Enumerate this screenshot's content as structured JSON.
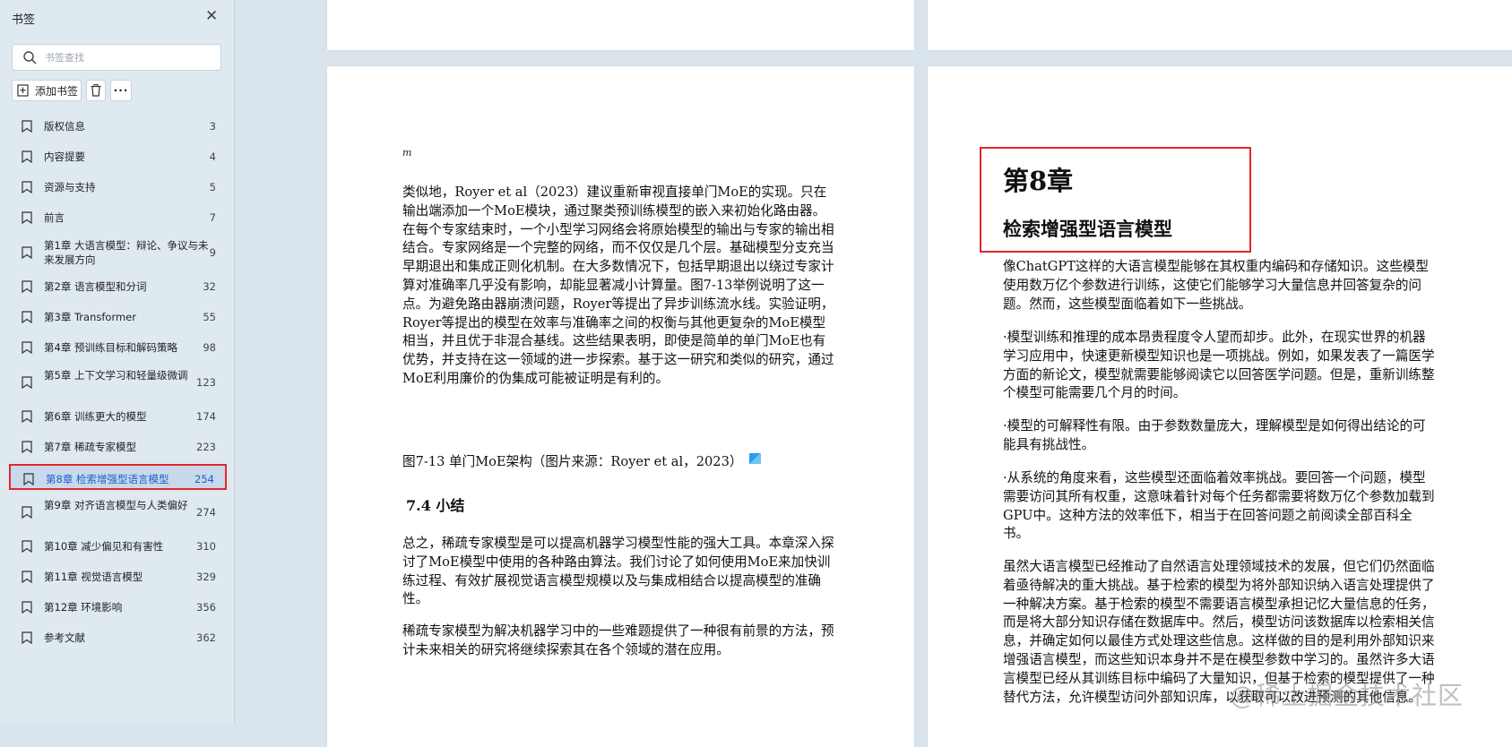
{
  "sidebar": {
    "title": "书签",
    "search": {
      "placeholder": "书签查找",
      "value": ""
    },
    "add_label": "添加书签",
    "more_label": "···",
    "items": [
      {
        "label": "版权信息",
        "page": "3"
      },
      {
        "label": "内容提要",
        "page": "4"
      },
      {
        "label": "资源与支持",
        "page": "5"
      },
      {
        "label": "前言",
        "page": "7"
      },
      {
        "label": "第1章 大语言模型：辩论、争议与未来发展方向",
        "page": "9"
      },
      {
        "label": "第2章 语言模型和分词",
        "page": "32"
      },
      {
        "label": "第3章 Transformer",
        "page": "55"
      },
      {
        "label": "第4章 预训练目标和解码策略",
        "page": "98"
      },
      {
        "label": "第5章 上下文学习和轻量级微调",
        "page": "123"
      },
      {
        "label": "第6章 训练更大的模型",
        "page": "174"
      },
      {
        "label": "第7章 稀疏专家模型",
        "page": "223"
      },
      {
        "label": "第8章 检索增强型语言模型",
        "page": "254",
        "active": true
      },
      {
        "label": "第9章 对齐语言模型与人类偏好",
        "page": "274"
      },
      {
        "label": "第10章 减少偏见和有害性",
        "page": "310"
      },
      {
        "label": "第11章 视觉语言模型",
        "page": "329"
      },
      {
        "label": "第12章 环境影响",
        "page": "356"
      },
      {
        "label": "参考文献",
        "page": "362"
      }
    ]
  },
  "left_page": {
    "marker": "m",
    "para1": "类似地，Royer et al（2023）建议重新审视直接单门MoE的实现。只在输出端添加一个MoE模块，通过聚类预训练模型的嵌入来初始化路由器。在每个专家结束时，一个小型学习网络会将原始模型的输出与专家的输出相结合。专家网络是一个完整的网络，而不仅仅是几个层。基础模型分支充当早期退出和集成正则化机制。在大多数情况下，包括早期退出以绕过专家计算对准确率几乎没有影响，却能显著减小计算量。图7-13举例说明了这一点。为避免路由器崩溃问题，Royer等提出了异步训练流水线。实验证明，Royer等提出的模型在效率与准确率之间的权衡与其他更复杂的MoE模型相当，并且优于非混合基线。这些结果表明，即使是简单的单门MoE也有优势，并支持在这一领域的进一步探索。基于这一研究和类似的研究，通过MoE利用廉价的伪集成可能被证明是有利的。",
    "figure_caption": "图7-13 单门MoE架构（图片来源：Royer et al，2023）",
    "section_heading": "7.4 小结",
    "para2": "总之，稀疏专家模型是可以提高机器学习模型性能的强大工具。本章深入探讨了MoE模型中使用的各种路由算法。我们讨论了如何使用MoE来加快训练过程、有效扩展视觉语言模型规模以及与集成相结合以提高模型的准确性。",
    "para3": "稀疏专家模型为解决机器学习中的一些难题提供了一种很有前景的方法，预计未来相关的研究将继续探索其在各个领域的潜在应用。"
  },
  "right_page": {
    "chapter_number": "第8章",
    "chapter_title": "检索增强型语言模型",
    "para1": "像ChatGPT这样的大语言模型能够在其权重内编码和存储知识。这些模型使用数万亿个参数进行训练，这使它们能够学习大量信息并回答复杂的问题。然而，这些模型面临着如下一些挑战。",
    "para2": "·模型训练和推理的成本昂贵程度令人望而却步。此外，在现实世界的机器学习应用中，快速更新模型知识也是一项挑战。例如，如果发表了一篇医学方面的新论文，模型就需要能够阅读它以回答医学问题。但是，重新训练整个模型可能需要几个月的时间。",
    "para3": "·模型的可解释性有限。由于参数数量庞大，理解模型是如何得出结论的可能具有挑战性。",
    "para4": "·从系统的角度来看，这些模型还面临着效率挑战。要回答一个问题，模型需要访问其所有权重，这意味着针对每个任务都需要将数万亿个参数加载到GPU中。这种方法的效率低下，相当于在回答问题之前阅读全部百科全书。",
    "para5": "虽然大语言模型已经推动了自然语言处理领域技术的发展，但它们仍然面临着亟待解决的重大挑战。基于检索的模型为将外部知识纳入语言处理提供了一种解决方案。基于检索的模型不需要语言模型承担记忆大量信息的任务，而是将大部分知识存储在数据库中。然后，模型访问该数据库以检索相关信息，并确定如何以最佳方式处理这些信息。这样做的目的是利用外部知识来增强语言模型，而这些知识本身并不是在模型参数中学习的。虽然许多大语言模型已经从其训练目标中编码了大量知识，但基于检索的模型提供了一种替代方法，允许模型访问外部知识库，以获取可以改进预测的其他信息。"
  },
  "watermark": "@稀土掘金技术社区",
  "colors": {
    "highlight_border": "#e0262b",
    "active_text": "#1a5fc8"
  }
}
